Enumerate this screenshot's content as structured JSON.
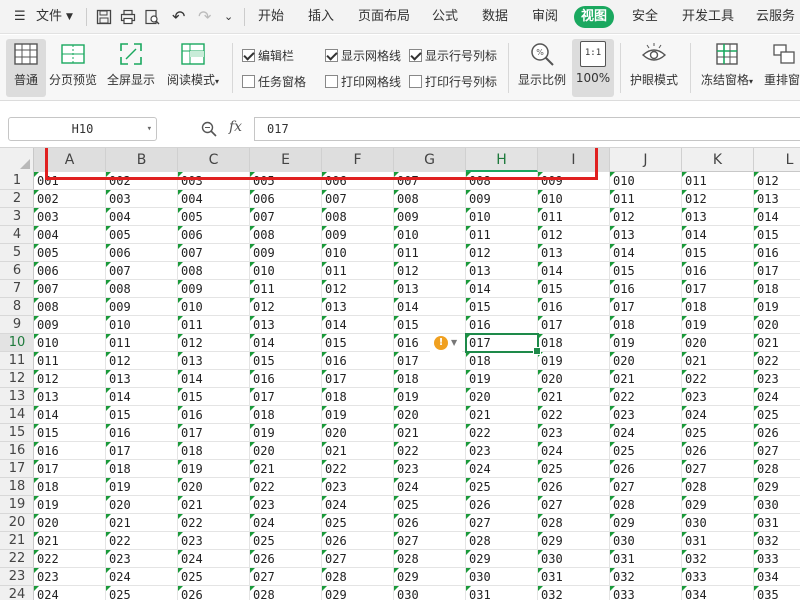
{
  "menubar": {
    "file_label": "文件",
    "tabs": [
      "开始",
      "插入",
      "页面布局",
      "公式",
      "数据",
      "审阅",
      "视图",
      "安全",
      "开发工具",
      "云服务"
    ],
    "active_tab": "视图"
  },
  "ribbon": {
    "view_modes": [
      {
        "label": "普通",
        "active": true
      },
      {
        "label": "分页预览",
        "active": false
      },
      {
        "label": "全屏显示",
        "active": false
      },
      {
        "label": "阅读模式",
        "active": false
      }
    ],
    "checkboxes": [
      {
        "label": "编辑栏",
        "checked": true
      },
      {
        "label": "任务窗格",
        "checked": false
      },
      {
        "label": "显示网格线",
        "checked": true
      },
      {
        "label": "打印网格线",
        "checked": false
      },
      {
        "label": "显示行号列标",
        "checked": true
      },
      {
        "label": "打印行号列标",
        "checked": false
      }
    ],
    "zoom_label": "显示比例",
    "zoom_100_label": "100%",
    "zoom_100_icon_text": "1:1",
    "eye_mode_label": "护眼模式",
    "freeze_label": "冻结窗格",
    "rearrange_label": "重排窗"
  },
  "formula_bar": {
    "name_box": "H10",
    "fx_label": "fx",
    "formula_value": "017"
  },
  "grid": {
    "columns": [
      "A",
      "B",
      "C",
      "E",
      "F",
      "G",
      "H",
      "I",
      "J",
      "K",
      "L"
    ],
    "highlighted_columns": [
      "A",
      "B",
      "C",
      "E",
      "F",
      "G",
      "H",
      "I"
    ],
    "active_column": "H",
    "rows": [
      "1",
      "2",
      "3",
      "4",
      "5",
      "6",
      "7",
      "8",
      "9",
      "10",
      "11",
      "12",
      "13",
      "14",
      "15",
      "16",
      "17",
      "18",
      "19",
      "20",
      "21",
      "22",
      "23",
      "24"
    ],
    "active_row": "10",
    "start_values": [
      1,
      2,
      3,
      5,
      6,
      7,
      8,
      9,
      10,
      11,
      12
    ],
    "selected_cell": {
      "row": 10,
      "col": 7
    }
  },
  "colors": {
    "accent": "#1aa85f",
    "annotation": "#e02020",
    "warning": "#f0a020"
  }
}
